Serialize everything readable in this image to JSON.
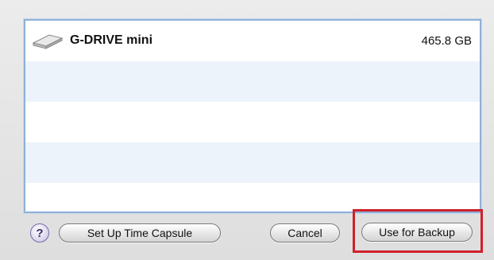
{
  "drives": [
    {
      "name": "G-DRIVE mini",
      "size": "465.8 GB",
      "icon": "external-drive-icon"
    }
  ],
  "buttons": {
    "help": "?",
    "setup_time_capsule": "Set Up Time Capsule",
    "cancel": "Cancel",
    "use_for_backup": "Use for Backup"
  },
  "colors": {
    "highlight": "#d0202a",
    "list_border": "#8fb0d8",
    "alt_row": "#edf3fb"
  }
}
